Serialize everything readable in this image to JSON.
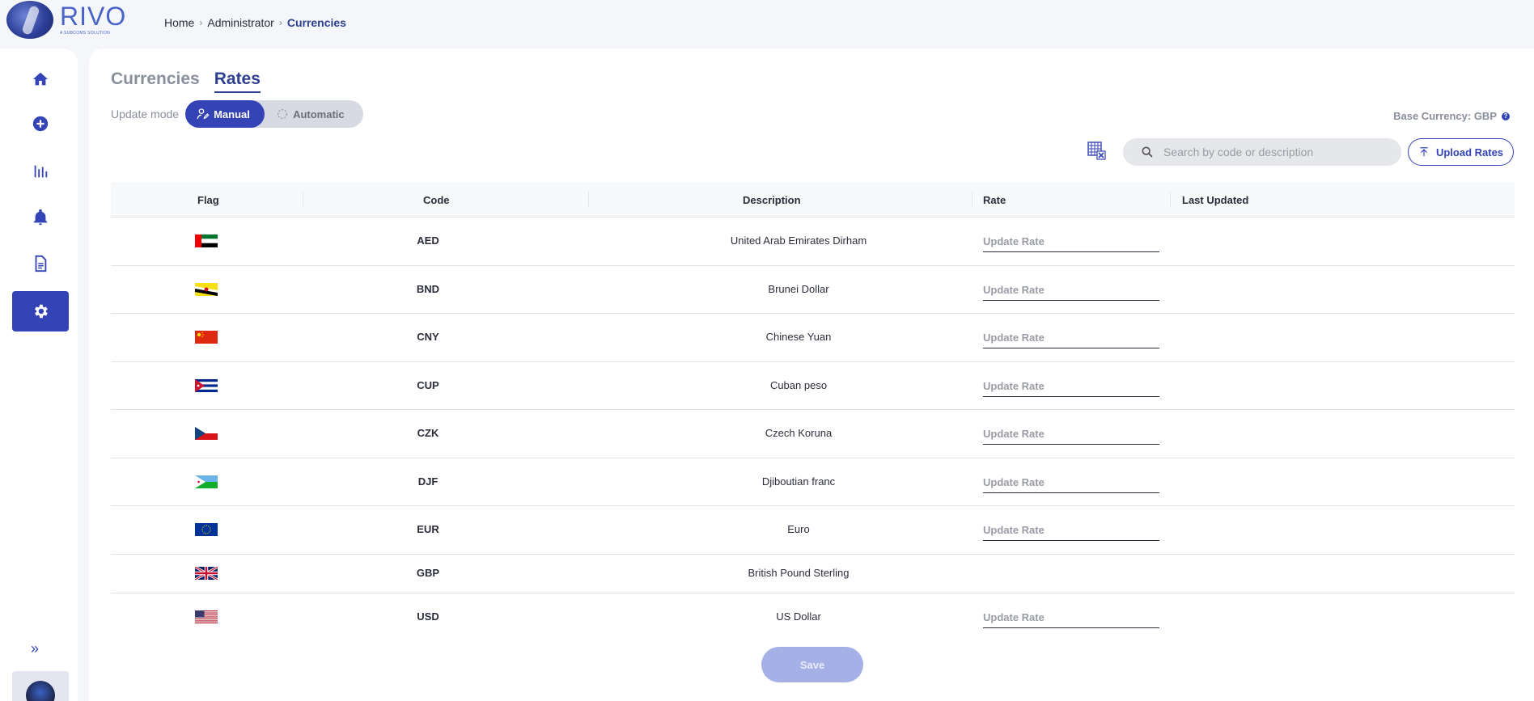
{
  "app": {
    "logo_text": "RIVO",
    "logo_sub": "A SUBCOMS SOLUTION"
  },
  "breadcrumb": [
    "Home",
    "Administrator",
    "Currencies"
  ],
  "sidebar": {
    "items": [
      {
        "icon": "home-icon",
        "active": false
      },
      {
        "icon": "add-circle-icon",
        "active": false
      },
      {
        "icon": "bar-chart-icon",
        "active": false
      },
      {
        "icon": "bell-icon",
        "active": false
      },
      {
        "icon": "document-icon",
        "active": false
      },
      {
        "icon": "gear-icon",
        "active": true
      }
    ],
    "expand_icon": "double-chevron-right-icon"
  },
  "tabs": [
    "Currencies",
    "Rates"
  ],
  "active_tab": "Rates",
  "update_mode": {
    "label": "Update mode",
    "options": [
      "Manual",
      "Automatic"
    ],
    "selected": "Manual"
  },
  "base_currency": "Base Currency: GBP",
  "search": {
    "placeholder": "Search by code or description",
    "value": ""
  },
  "upload_label": "Upload Rates",
  "table": {
    "headers": [
      "Flag",
      "Code",
      "Description",
      "Rate",
      "Last Updated"
    ],
    "rate_placeholder": "Update Rate",
    "rows": [
      {
        "flag": "ae",
        "code": "AED",
        "description": "United Arab Emirates Dirham",
        "editable": true
      },
      {
        "flag": "bn",
        "code": "BND",
        "description": "Brunei Dollar",
        "editable": true
      },
      {
        "flag": "cn",
        "code": "CNY",
        "description": "Chinese Yuan",
        "editable": true
      },
      {
        "flag": "cu",
        "code": "CUP",
        "description": "Cuban peso",
        "editable": true
      },
      {
        "flag": "cz",
        "code": "CZK",
        "description": "Czech Koruna",
        "editable": true
      },
      {
        "flag": "dj",
        "code": "DJF",
        "description": "Djiboutian franc",
        "editable": true
      },
      {
        "flag": "eu",
        "code": "EUR",
        "description": "Euro",
        "editable": true
      },
      {
        "flag": "gb",
        "code": "GBP",
        "description": "British Pound Sterling",
        "editable": false
      },
      {
        "flag": "us",
        "code": "USD",
        "description": "US Dollar",
        "editable": true
      }
    ]
  },
  "save_label": "Save",
  "colors": {
    "accent": "#3443b6",
    "title": "#2e3f8f",
    "muted": "#8a8f9c",
    "disabled_button": "#a5b0e6"
  }
}
